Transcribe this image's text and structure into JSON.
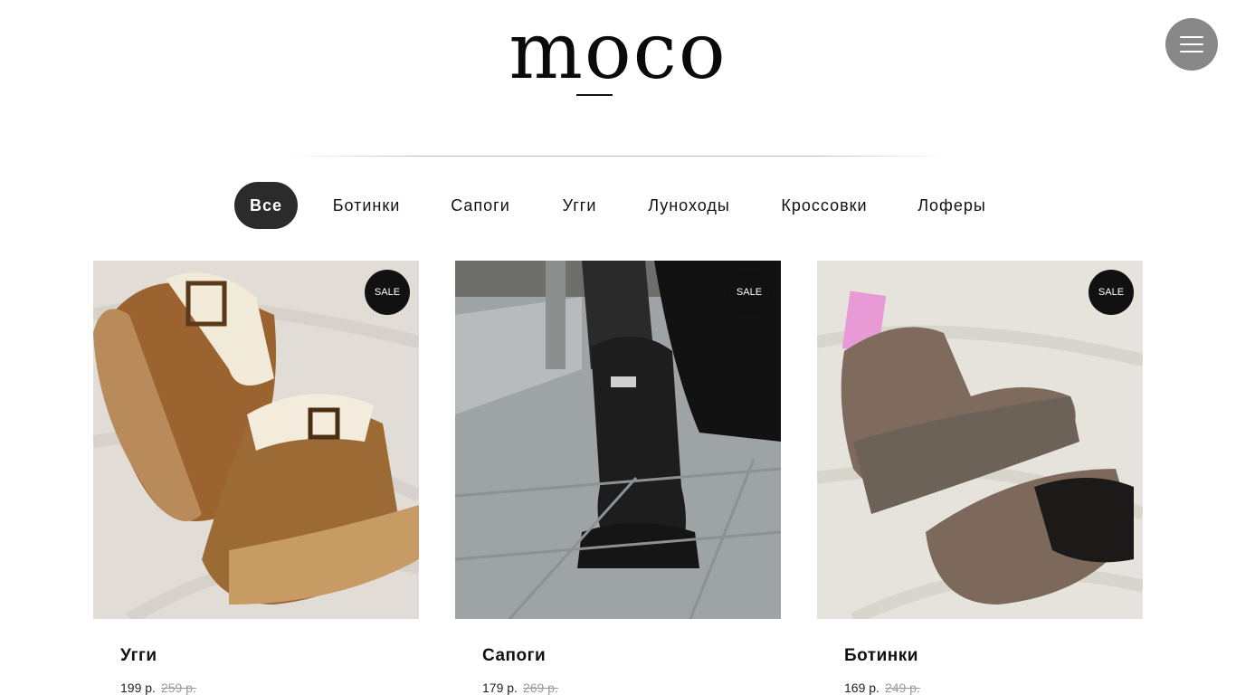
{
  "header": {
    "logo": "moco",
    "menu_icon": "hamburger-icon"
  },
  "categories": [
    {
      "label": "Все",
      "active": true
    },
    {
      "label": "Ботинки",
      "active": false
    },
    {
      "label": "Сапоги",
      "active": false
    },
    {
      "label": "Угги",
      "active": false
    },
    {
      "label": "Луноходы",
      "active": false
    },
    {
      "label": "Кроссовки",
      "active": false
    },
    {
      "label": "Лоферы",
      "active": false
    }
  ],
  "products": [
    {
      "badge": "SALE",
      "title": "Угги",
      "price": "199 р.",
      "old_price": "259 р."
    },
    {
      "badge": "SALE",
      "title": "Сапоги",
      "price": "179 р.",
      "old_price": "269 р."
    },
    {
      "badge": "SALE",
      "title": "Ботинки",
      "price": "169 р.",
      "old_price": "249 р."
    }
  ],
  "colors": {
    "active_tab": "#2b2b2b",
    "menu_button": "#888888",
    "badge": "#111111",
    "old_price": "#9a9a9a"
  }
}
